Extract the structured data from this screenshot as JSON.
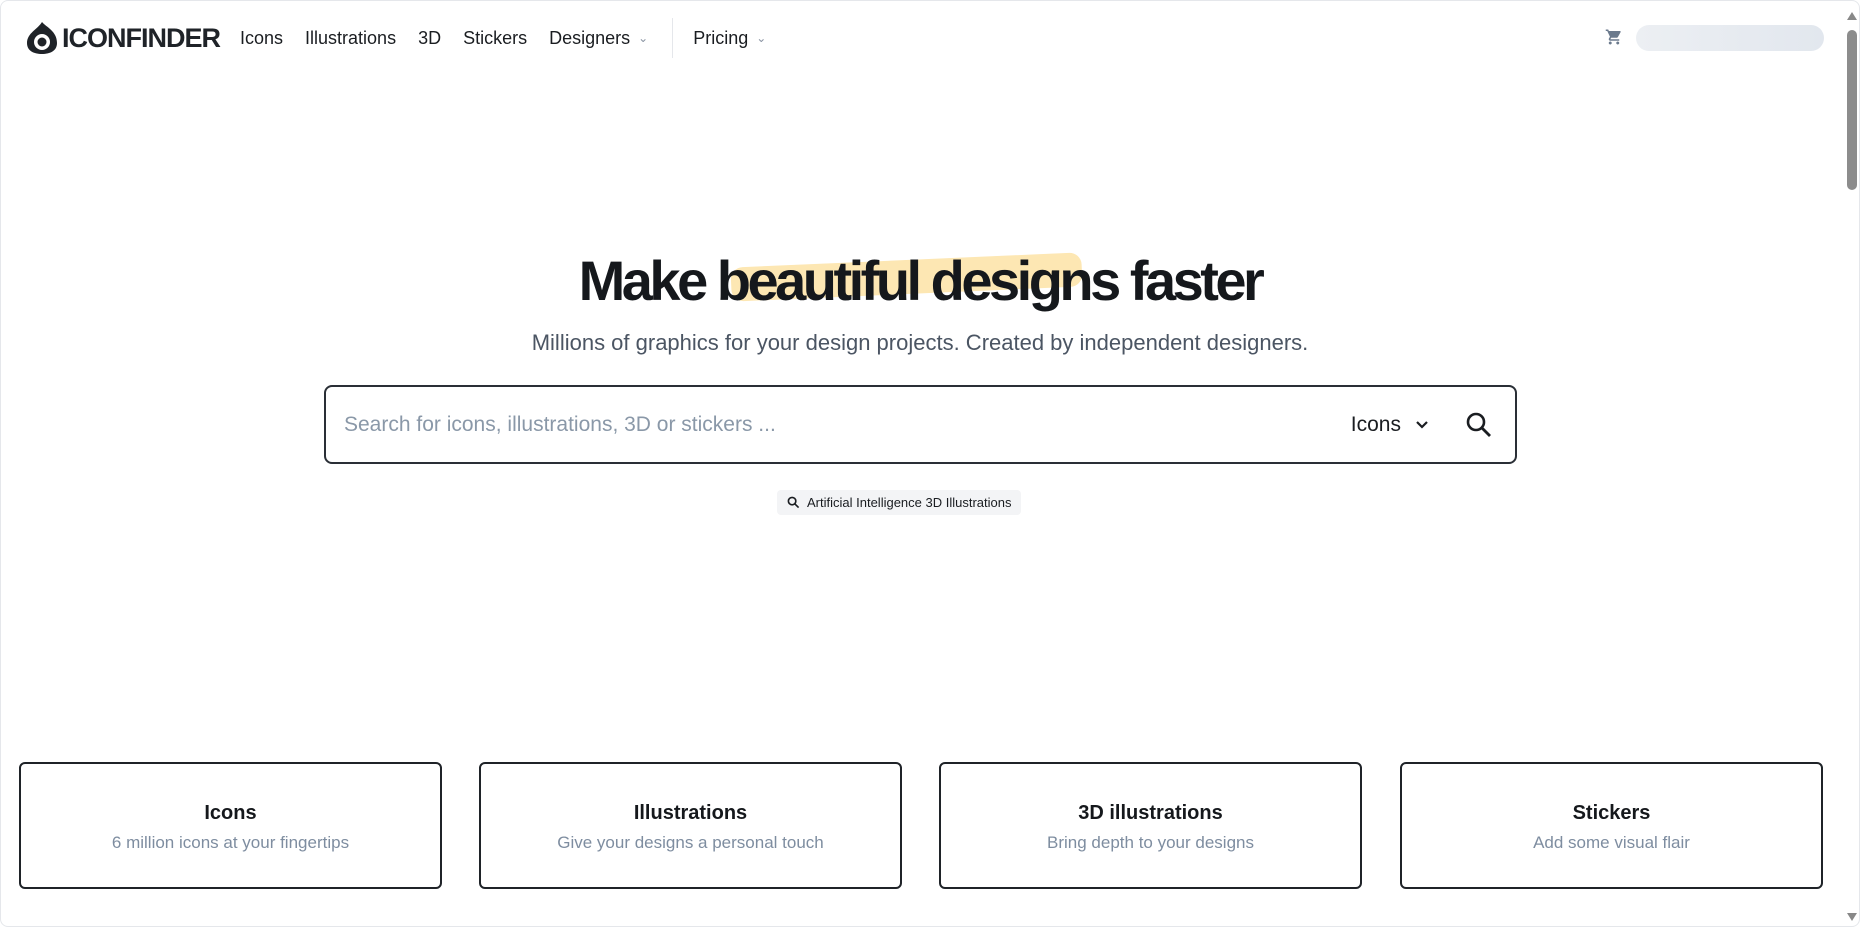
{
  "nav": {
    "brand": "ICONFINDER",
    "items": [
      "Icons",
      "Illustrations",
      "3D",
      "Stickers",
      "Designers",
      "Pricing"
    ]
  },
  "hero": {
    "title_pre": "Make ",
    "title_highlight": "beautiful designs",
    "title_post": " faster",
    "subtitle": "Millions of graphics for your design projects. Created by independent designers."
  },
  "search": {
    "placeholder": "Search for icons, illustrations, 3D or stickers ...",
    "value": "",
    "type": "Icons"
  },
  "suggestion": "Artificial Intelligence 3D Illustrations",
  "cards": [
    {
      "title": "Icons",
      "subtitle": "6 million icons at your fingertips"
    },
    {
      "title": "Illustrations",
      "subtitle": "Give your designs a personal touch"
    },
    {
      "title": "3D illustrations",
      "subtitle": "Bring depth to your designs"
    },
    {
      "title": "Stickers",
      "subtitle": "Add some visual flair"
    }
  ],
  "colors": {
    "highlight": "#fde7b3",
    "text": "#15181c",
    "muted": "#7e8da0"
  }
}
